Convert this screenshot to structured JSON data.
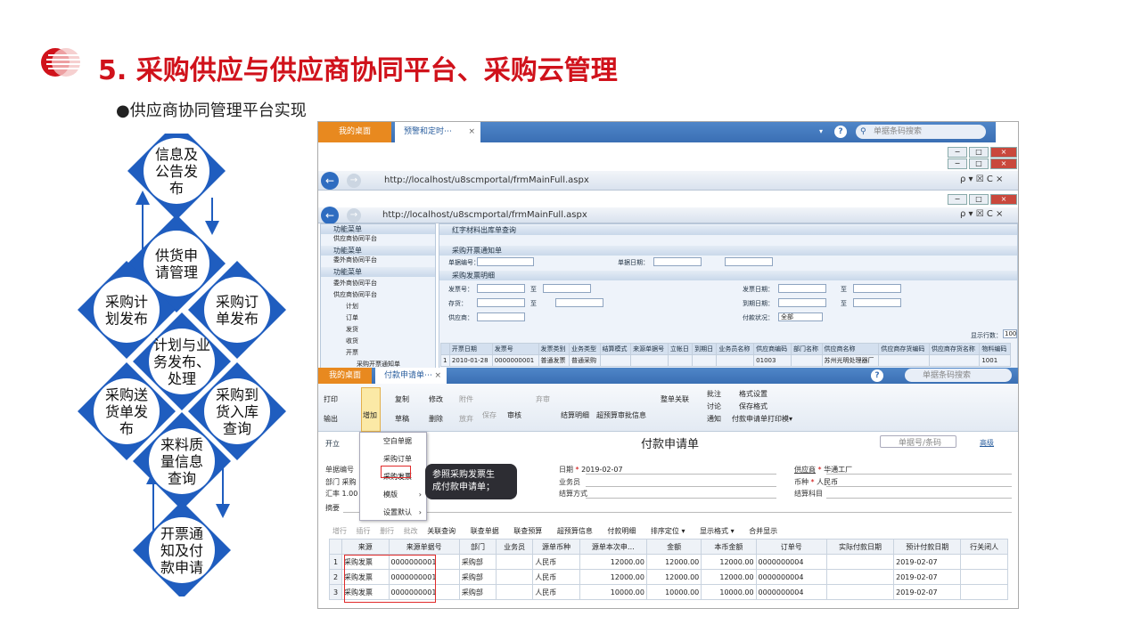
{
  "slide": {
    "title": "5. 采购供应与供应商协同平台、采购云管理",
    "subtitle": "●供应商协同管理平台实现"
  },
  "flow": {
    "nodes": [
      {
        "id": "info",
        "lines": [
          "信息及",
          "公告发",
          "布"
        ]
      },
      {
        "id": "supply_req",
        "lines": [
          "供货申",
          "请管理"
        ]
      },
      {
        "id": "plan_pub",
        "lines": [
          "采购计",
          "划发布"
        ]
      },
      {
        "id": "order_pub",
        "lines": [
          "采购订",
          "单发布"
        ]
      },
      {
        "id": "plan_biz",
        "lines": [
          "计划与业",
          "务发布、",
          "处理"
        ]
      },
      {
        "id": "delivery",
        "lines": [
          "采购送",
          "货单发",
          "布"
        ]
      },
      {
        "id": "arrival",
        "lines": [
          "采购到",
          "货入库",
          "查询"
        ]
      },
      {
        "id": "quality",
        "lines": [
          "来料质",
          "量信息",
          "查询"
        ]
      },
      {
        "id": "invoice",
        "lines": [
          "开票通",
          "知及付",
          "款申请"
        ]
      }
    ],
    "colors": {
      "node": "#1f5dbf",
      "node_inner": "#ffffff",
      "arrow": "#1f5dbf"
    }
  },
  "screenshot": {
    "top_tabs": {
      "home": "我的桌面",
      "active": "预警和定时⋯",
      "close": "×"
    },
    "top_search_placeholder": "单据条码搜索",
    "browser1": {
      "url": "http://localhost/u8scmportal/frmMainFull.aspx",
      "tools": "ρ ▾ ☒ C ×"
    },
    "browser2": {
      "url": "http://localhost/u8scmportal/frmMainFull.aspx",
      "tools": "ρ ▾ ☒ C ×"
    },
    "win_buttons": {
      "min": "−",
      "max": "□",
      "close": "×"
    },
    "menu_panels": [
      {
        "header": "功能菜单",
        "items": [
          "供应商协同平台"
        ]
      },
      {
        "header": "功能菜单",
        "items": [
          "委外商协同平台"
        ]
      },
      {
        "header": "功能菜单",
        "items": [
          "委外商协同平台",
          "供应商协同平台",
          "计划",
          "订单",
          "发货",
          "收货",
          "开票",
          "采购开票通知单"
        ]
      }
    ],
    "query_sections": {
      "s1": "红字材料出库单查询",
      "s2": "采购开票通知单",
      "s2_fields": [
        "单据编号：",
        "单据日期："
      ],
      "s3": "采购发票明细",
      "s3_left": [
        "发票号：",
        "存货：",
        "供应商："
      ],
      "s3_right": [
        "发票日期：",
        "到期日期：",
        "付款状况："
      ],
      "to": "至",
      "status_value": "全部",
      "rows_label": "显示行数：",
      "rows_value": "100"
    },
    "grid1": {
      "headers": [
        "",
        "开票日期",
        "发票号",
        "发票类别",
        "业务类型",
        "结算模式",
        "来源单据号",
        "立帐日",
        "到期日",
        "业务员名称",
        "供应商编码",
        "部门名称",
        "供应商名称",
        "供应商存货编码",
        "供应商存货名称",
        "物料编码"
      ],
      "row": [
        "1",
        "2010-01-28",
        "0000000001",
        "普通发票",
        "普通采购",
        "",
        "",
        "",
        "",
        "",
        "01003",
        "",
        "苏州光明处理器厂",
        "",
        "",
        "1001"
      ]
    },
    "inner_tabs": {
      "home": "我的桌面",
      "active": "付款申请单⋯",
      "close": "×"
    },
    "inner_search_placeholder": "单据条码搜索",
    "toolbar": {
      "print": "打印",
      "export": "输出",
      "add": "增加",
      "copy": "复制",
      "draft": "草稿",
      "edit": "修改",
      "delete": "删除",
      "attach": "附件",
      "abandon": "放弃",
      "save": "保存",
      "audit": "审核",
      "reject": "弃审",
      "settle": "结算明细",
      "budget": "超预算审批信息",
      "link": "整单关联",
      "note": "批注",
      "discuss": "讨论",
      "notify": "通知",
      "format": "格式设置",
      "save_format": "保存格式",
      "print_tpl": "付款申请单打印模▾"
    },
    "doc": {
      "open": "开立",
      "title": "付款申请单",
      "search_placeholder": "单据号/条码",
      "advanced": "高级",
      "date_label": "日期",
      "date_value": "2019-02-07",
      "clerk_label": "业务员",
      "settle_label": "结算方式",
      "supplier_label": "供应商",
      "supplier_value": "华通工厂",
      "currency_label": "币种",
      "currency_value": "人民币",
      "subject_label": "结算科目",
      "docno_label": "单据编号",
      "dept_label": "部门",
      "dept_value": "采购",
      "rate_label": "汇率",
      "rate_value": "1.00",
      "summary_label": "摘要"
    },
    "add_menu": {
      "items": [
        "空白单据",
        "采购订单",
        "采购发票",
        "模版",
        "设置默认"
      ],
      "arrow": "›"
    },
    "tooltip": {
      "line1": "参照采购发票生",
      "line2": "成付款申请单；"
    },
    "grid_tools": [
      "增行",
      "插行",
      "删行",
      "批改",
      "关联查询",
      "联查单据",
      "联查预算",
      "超预算信息",
      "付款明细",
      "排序定位 ▾",
      "显示格式 ▾",
      "合并显示"
    ],
    "grid2": {
      "headers": [
        "",
        "来源",
        "来源单据号",
        "部门",
        "业务员",
        "源单币种",
        "源单本次申…",
        "金额",
        "本币金额",
        "订单号",
        "实际付款日期",
        "预计付款日期",
        "行关闭人"
      ],
      "rows": [
        [
          "1",
          "采购发票",
          "0000000001",
          "采购部",
          "",
          "人民币",
          "12000.00",
          "12000.00",
          "12000.00",
          "0000000004",
          "",
          "2019-02-07",
          ""
        ],
        [
          "2",
          "采购发票",
          "0000000001",
          "采购部",
          "",
          "人民币",
          "12000.00",
          "12000.00",
          "12000.00",
          "0000000004",
          "",
          "2019-02-07",
          ""
        ],
        [
          "3",
          "采购发票",
          "0000000001",
          "采购部",
          "",
          "人民币",
          "10000.00",
          "10000.00",
          "10000.00",
          "0000000004",
          "",
          "2019-02-07",
          ""
        ]
      ]
    }
  }
}
